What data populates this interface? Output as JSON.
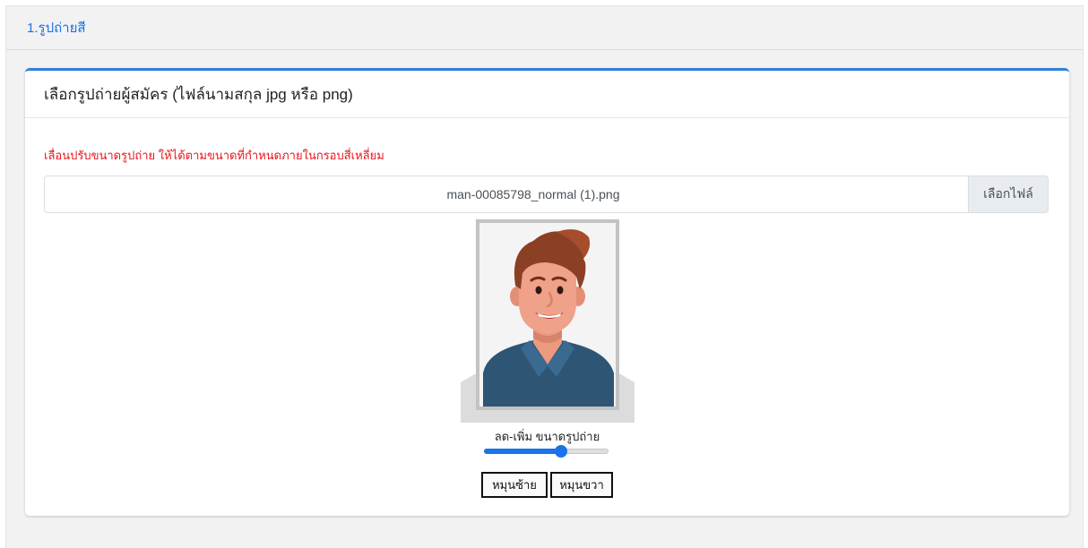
{
  "section": {
    "title": "1.รูปถ่ายสี"
  },
  "card": {
    "title": "เลือกรูปถ่ายผู้สมัคร (ไฟล์นามสกุล jpg หรือ png)",
    "hint": "เลื่อนปรับขนาดรูปถ่าย ให้ได้ตามขนาดที่กำหนดภายในกรอบสี่เหลี่ยม"
  },
  "file_input": {
    "file_name": "man-00085798_normal (1).png",
    "browse_label": "เลือกไฟล์"
  },
  "zoom": {
    "label": "ลด-เพิ่ม ขนาดรูปถ่าย",
    "level_fraction": 0.62
  },
  "buttons": {
    "rotate_left": "หมุนซ้าย",
    "rotate_right": "หมุนขวา"
  },
  "colors": {
    "accent": "#1a73e8",
    "hint": "#e8161e",
    "card_border": "#2f80d8"
  }
}
